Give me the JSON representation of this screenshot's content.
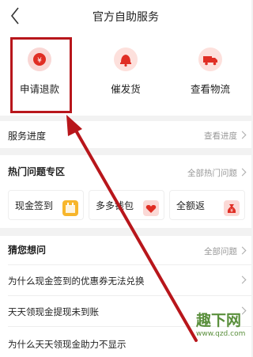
{
  "header": {
    "title": "官方自助服务"
  },
  "services": [
    {
      "label": "申请退款",
      "icon": "yen-icon"
    },
    {
      "label": "催发货",
      "icon": "bell-icon"
    },
    {
      "label": "查看物流",
      "icon": "truck-icon"
    }
  ],
  "progress": {
    "label": "服务进度",
    "link": "查看进度"
  },
  "hot": {
    "title": "热门问题专区",
    "link": "全部热门问题",
    "cards": [
      {
        "label": "现金签到",
        "icon": "calendar-icon"
      },
      {
        "label": "多多钱包",
        "icon": "wallet-heart-icon"
      },
      {
        "label": "全额返",
        "icon": "money-bag-icon"
      }
    ]
  },
  "guess": {
    "title": "猜您想问",
    "link": "全部问题",
    "questions": [
      "为什么现金签到的优惠券无法兑换",
      "天天领现金提现未到账",
      "为什么天天领现金助力不显示"
    ]
  },
  "watermark": {
    "text": "趣下网",
    "url": "www.qzd.com"
  },
  "colors": {
    "accent": "#e02e24",
    "highlight": "#b8161b"
  }
}
